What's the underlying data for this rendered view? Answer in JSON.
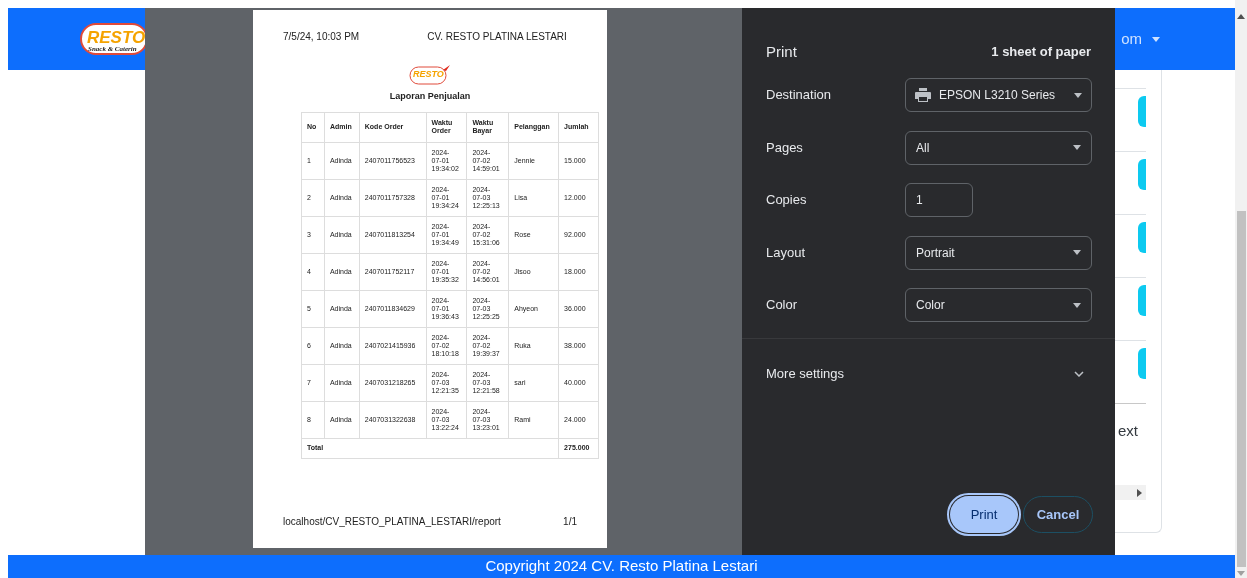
{
  "navbar": {
    "logo": {
      "title": "RESTO",
      "subtitle": "Snack & Caterin"
    },
    "user_menu": "om"
  },
  "pagination": {
    "next": "ext"
  },
  "footer": "Copyright 2024 CV. Resto Platina Lestari",
  "print_dialog": {
    "preview": {
      "header_left": "7/5/24, 10:03 PM",
      "header_center": "CV. RESTO PLATINA LESTARI",
      "logo": "RESTO",
      "report_title": "Laporan Penjualan",
      "columns": [
        "No",
        "Admin",
        "Kode Order",
        "Waktu Order",
        "Waktu Bayar",
        "Pelanggan",
        "Jumlah"
      ],
      "rows": [
        [
          "1",
          "Adinda",
          "2407011756523",
          "2024-\n07-01\n19:34:02",
          "2024-\n07-02\n14:59:01",
          "Jennie",
          "15.000"
        ],
        [
          "2",
          "Adinda",
          "2407011757328",
          "2024-\n07-01\n19:34:24",
          "2024-\n07-03\n12:25:13",
          "Lisa",
          "12.000"
        ],
        [
          "3",
          "Adinda",
          "2407011813254",
          "2024-\n07-01\n19:34:49",
          "2024-\n07-02\n15:31:06",
          "Rose",
          "92.000"
        ],
        [
          "4",
          "Adinda",
          "2407011752117",
          "2024-\n07-01\n19:35:32",
          "2024-\n07-02\n14:56:01",
          "Jisoo",
          "18.000"
        ],
        [
          "5",
          "Adinda",
          "2407011834629",
          "2024-\n07-01\n19:36:43",
          "2024-\n07-03\n12:25:25",
          "Ahyeon",
          "36.000"
        ],
        [
          "6",
          "Adinda",
          "2407021415936",
          "2024-\n07-02\n18:10:18",
          "2024-\n07-02\n19:39:37",
          "Ruka",
          "38.000"
        ],
        [
          "7",
          "Adinda",
          "2407031218265",
          "2024-\n07-03\n12:21:35",
          "2024-\n07-03\n12:21:58",
          "sari",
          "40.000"
        ],
        [
          "8",
          "Adinda",
          "2407031322638",
          "2024-\n07-03\n13:22:24",
          "2024-\n07-03\n13:23:01",
          "Rami",
          "24.000"
        ]
      ],
      "total_label": "Total",
      "total": "275.000",
      "footer_url": "localhost/CV_RESTO_PLATINA_LESTARI/report",
      "page_number": "1/1"
    },
    "title": "Print",
    "sheets": "1 sheet of paper",
    "settings": [
      {
        "kind": "destination",
        "label": "Destination",
        "value": "EPSON L3210 Series"
      },
      {
        "kind": "select",
        "label": "Pages",
        "value": "All"
      },
      {
        "kind": "number",
        "label": "Copies",
        "value": "1"
      },
      {
        "kind": "select",
        "label": "Layout",
        "value": "Portrait"
      },
      {
        "kind": "select",
        "label": "Color",
        "value": "Color"
      }
    ],
    "more_settings": {
      "label": "More settings",
      "expanded": false
    },
    "buttons": [
      {
        "kind": "primary",
        "label": "Print"
      },
      {
        "kind": "secondary",
        "label": "Cancel"
      }
    ]
  }
}
